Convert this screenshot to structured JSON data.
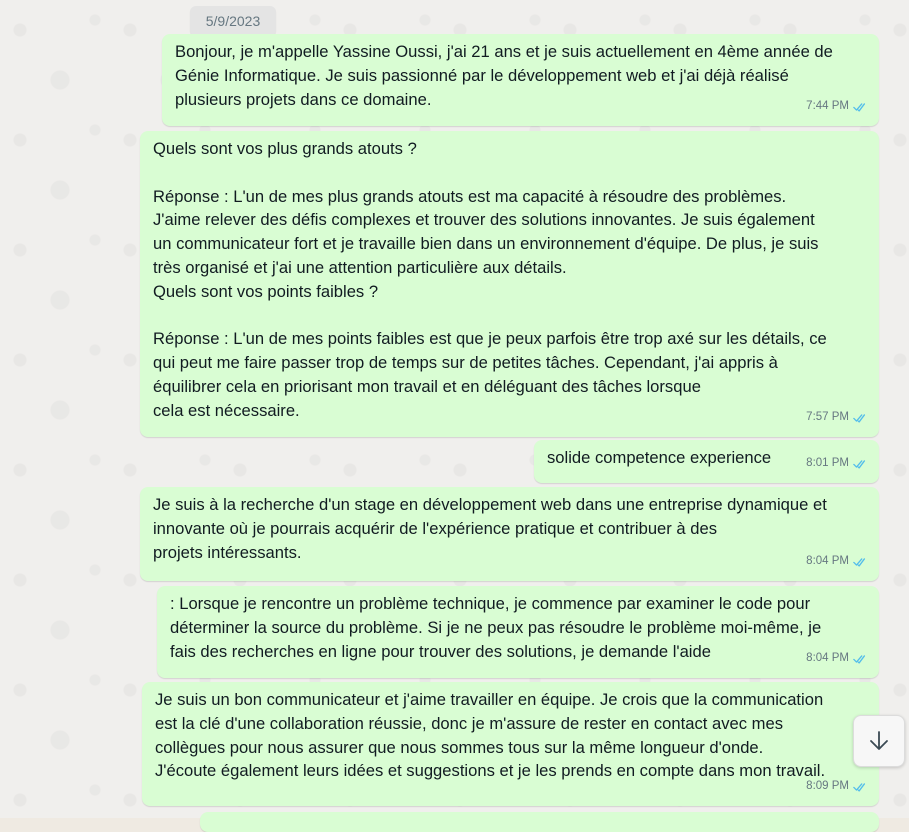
{
  "conversation": {
    "date_separator": "5/9/2023",
    "messages": [
      {
        "text": "Bonjour, je m'appelle Yassine Oussi, j'ai 21 ans et je suis actuellement en 4ème année de\nGénie Informatique. Je suis passionné par le développement web et j'ai déjà réalisé\nplusieurs projets dans ce domaine.",
        "time": "7:44 PM",
        "status": "read"
      },
      {
        "text": "Quels sont vos plus grands atouts ?\n\nRéponse : L'un de mes plus grands atouts est ma capacité à résoudre des problèmes.\nJ'aime relever des défis complexes et trouver des solutions innovantes. Je suis également\nun communicateur fort et je travaille bien dans un environnement d'équipe. De plus, je suis\ntrès organisé et j'ai une attention particulière aux détails.\nQuels sont vos points faibles ?\n\nRéponse : L'un de mes points faibles est que je peux parfois être trop axé sur les détails, ce\nqui peut me faire passer trop de temps sur de petites tâches. Cependant, j'ai appris à\néquilibrer cela en priorisant mon travail et en déléguant des tâches lorsque\ncela est nécessaire.",
        "time": "7:57 PM",
        "status": "read"
      },
      {
        "text": "solide competence experience",
        "time": "8:01 PM",
        "status": "read"
      },
      {
        "text": "Je suis à la recherche d'un stage en développement web dans une entreprise dynamique et\ninnovante où je pourrais acquérir de l'expérience pratique et contribuer à des\nprojets intéressants.",
        "time": "8:04 PM",
        "status": "read"
      },
      {
        "text": ": Lorsque je rencontre un problème technique, je commence par examiner le code pour\ndéterminer la source du problème. Si je ne peux pas résoudre le problème moi-même, je\nfais des recherches en ligne pour trouver des solutions, je demande l'aide",
        "time": "8:04 PM",
        "status": "read"
      },
      {
        "text": "Je suis un bon communicateur et j'aime travailler en équipe. Je crois que la communication\nest la clé d'une collaboration réussie, donc je m'assure de rester en contact avec mes\ncollègues pour nous assurer que nous sommes tous sur la même longueur d'onde.\nJ'écoute également leurs idées et suggestions et je les prends en compte dans mon travail.",
        "time": "8:09 PM",
        "status": "read"
      }
    ]
  },
  "icons": {
    "read_receipt": "double-check-icon",
    "scroll_down": "arrow-down-icon"
  },
  "colors": {
    "outgoing_bubble": "#d9fdd3",
    "read_tick": "#53bdeb",
    "meta_text": "#667781",
    "date_chip": "#e4e4e4"
  }
}
